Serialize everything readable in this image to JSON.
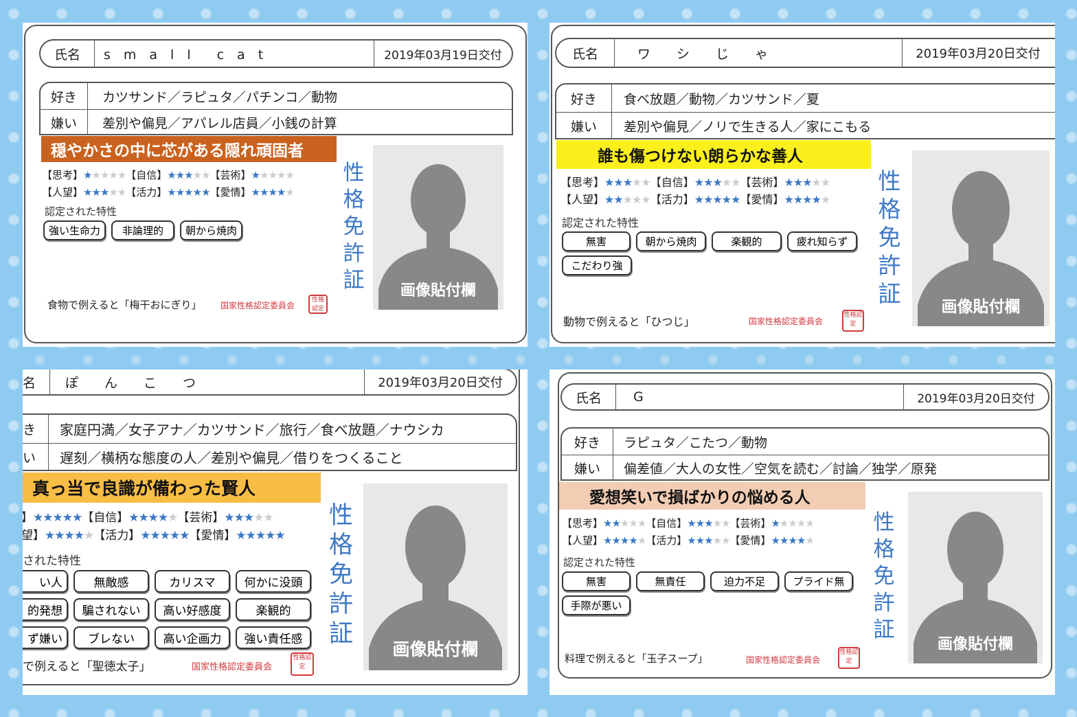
{
  "labels": {
    "name": "氏名",
    "likes": "好き",
    "dislikes": "嫌い",
    "traits_title": "認定された特性",
    "vertical_title": "性格免許証",
    "photo_caption": "画像貼付欄",
    "issuer": "国家性格認定委員会",
    "seal": "性格認定"
  },
  "colors": {
    "star_on": "#3b78c4",
    "star_off": "#cccccc",
    "vertical_text": "#3f79c4",
    "issuer": "#d0383d"
  },
  "cards": [
    {
      "name": "s　m　a　l　l　　c　a　t",
      "date": "2019年03月19日交付",
      "likes": "カツサンド／ラピュタ／パチンコ／動物",
      "dislikes": "差別や偏見／アパレル店員／小銭の計算",
      "title": "穏やかさの中に芯がある隠れ頑固者",
      "title_bg": "#c9621f",
      "title_color": "#ffffff",
      "stats": [
        {
          "label": "【思考】",
          "stars": 1
        },
        {
          "label": "【自信】",
          "stars": 3
        },
        {
          "label": "【芸術】",
          "stars": 1
        },
        {
          "label": "【人望】",
          "stars": 3
        },
        {
          "label": "【活力】",
          "stars": 5
        },
        {
          "label": "【愛情】",
          "stars": 4
        }
      ],
      "traits": [
        "強い生命力",
        "非論理的",
        "朝から焼肉"
      ],
      "footer": "食物で例えると「梅干おにぎり」"
    },
    {
      "name": "ワ　　シ　　じ　　ゃ",
      "date": "2019年03月20日交付",
      "likes": "食べ放題／動物／カツサンド／夏",
      "dislikes": "差別や偏見／ノリで生きる人／家にこもる",
      "title": "誰も傷つけない朗らかな善人",
      "title_bg": "#fbf01c",
      "title_color": "#111111",
      "stats": [
        {
          "label": "【思考】",
          "stars": 3
        },
        {
          "label": "【自信】",
          "stars": 3
        },
        {
          "label": "【芸術】",
          "stars": 3
        },
        {
          "label": "【人望】",
          "stars": 2
        },
        {
          "label": "【活力】",
          "stars": 5
        },
        {
          "label": "【愛情】",
          "stars": 4
        }
      ],
      "traits": [
        "無害",
        "朝から焼肉",
        "楽観的",
        "疲れ知らず",
        "こだわり強"
      ],
      "footer": "動物で例えると「ひつじ」"
    },
    {
      "name": "ぽ　　ん　　こ　　つ",
      "date": "2019年03月20日交付",
      "likes": "家庭円満／女子アナ／カツサンド／旅行／食べ放題／ナウシカ",
      "dislikes": "遅刻／横柄な態度の人／差別や偏見／借りをつくること",
      "title": "真っ当で良識が備わった賢人",
      "title_bg": "#f8bd45",
      "title_color": "#111111",
      "label_name_partial": "名",
      "label_likes_partial": "き",
      "label_dislikes_partial": "い",
      "traits_title_partial": "された特性",
      "stats_partial": [
        {
          "label": "】",
          "stars": 5
        },
        {
          "label": "【自信】",
          "stars": 4
        },
        {
          "label": "【芸術】",
          "stars": 3
        },
        {
          "label": "望】",
          "stars": 4
        },
        {
          "label": "【活力】",
          "stars": 5
        },
        {
          "label": "【愛情】",
          "stars": 5
        }
      ],
      "traits": [
        "い人",
        "無敵感",
        "カリスマ",
        "何かに没頭",
        "的発想",
        "騙されない",
        "高い好感度",
        "楽観的",
        "ず嫌い",
        "ブレない",
        "高い企画力",
        "強い責任感"
      ],
      "footer": "で例えると「聖徳太子」"
    },
    {
      "name": "G",
      "date": "2019年03月20日交付",
      "likes": "ラピュタ／こたつ／動物",
      "dislikes": "偏差値／大人の女性／空気を読む／討論／独学／原発",
      "title": "愛想笑いで損ばかりの悩める人",
      "title_bg": "#f3cdb3",
      "title_color": "#111111",
      "stats": [
        {
          "label": "【思考】",
          "stars": 2
        },
        {
          "label": "【自信】",
          "stars": 3
        },
        {
          "label": "【芸術】",
          "stars": 1
        },
        {
          "label": "【人望】",
          "stars": 4
        },
        {
          "label": "【活力】",
          "stars": 3
        },
        {
          "label": "【愛情】",
          "stars": 4
        }
      ],
      "traits": [
        "無害",
        "無責任",
        "迫力不足",
        "プライド無",
        "手際が悪い"
      ],
      "footer": "料理で例えると「玉子スープ」"
    }
  ]
}
